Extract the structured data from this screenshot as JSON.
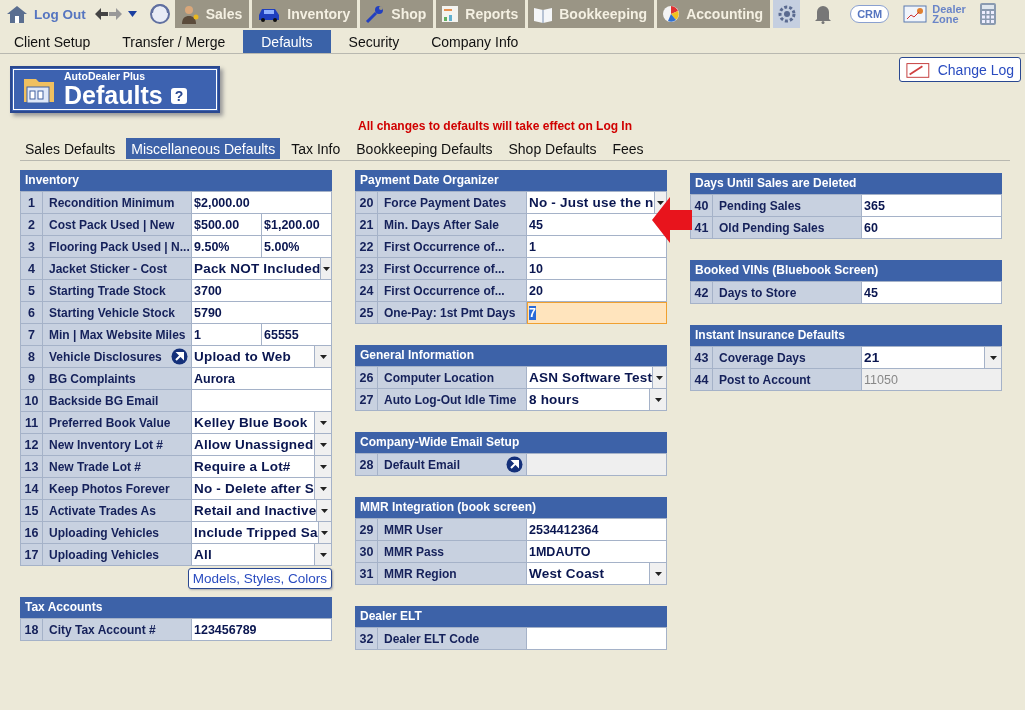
{
  "top_nav": {
    "logout": "Log Out",
    "tabs": [
      {
        "label": "Sales"
      },
      {
        "label": "Inventory"
      },
      {
        "label": "Shop"
      },
      {
        "label": "Reports"
      },
      {
        "label": "Bookkeeping"
      },
      {
        "label": "Accounting"
      }
    ],
    "crm": "CRM",
    "dealer_zone": "Dealer Zone"
  },
  "menu": [
    {
      "label": "Client Setup",
      "selected": false
    },
    {
      "label": "Transfer / Merge",
      "selected": false
    },
    {
      "label": "Defaults",
      "selected": true
    },
    {
      "label": "Security",
      "selected": false
    },
    {
      "label": "Company Info",
      "selected": false
    }
  ],
  "page_title": {
    "product": "AutoDealer Plus",
    "title": "Defaults",
    "help": "?"
  },
  "change_log": "Change Log",
  "notice": "All changes to defaults will take effect on Log In",
  "subtabs": [
    {
      "label": "Sales Defaults",
      "selected": false
    },
    {
      "label": "Miscellaneous Defaults",
      "selected": true
    },
    {
      "label": "Tax Info",
      "selected": false
    },
    {
      "label": "Bookkeeping Defaults",
      "selected": false
    },
    {
      "label": "Shop Defaults",
      "selected": false
    },
    {
      "label": "Fees",
      "selected": false
    }
  ],
  "columns": [
    [
      {
        "title": "Inventory",
        "button": "Models, Styles, Colors",
        "rows": [
          {
            "number": "1",
            "label": "Recondition Minimum",
            "kind": "text",
            "value": "$2,000.00",
            "linked": false,
            "focused": false
          },
          {
            "number": "2",
            "label": "Cost Pack Used | New",
            "kind": "pair",
            "values": [
              "$500.00",
              "$1,200.00"
            ],
            "linked": false,
            "focused": false
          },
          {
            "number": "3",
            "label": "Flooring Pack Used | N...",
            "kind": "pair",
            "values": [
              "9.50%",
              "5.00%"
            ],
            "linked": false,
            "focused": false
          },
          {
            "number": "4",
            "label": "Jacket Sticker - Cost",
            "kind": "select",
            "value": "Pack NOT Included",
            "linked": false,
            "focused": false
          },
          {
            "number": "5",
            "label": "Starting Trade Stock",
            "kind": "text",
            "value": "3700",
            "linked": false,
            "focused": false
          },
          {
            "number": "6",
            "label": "Starting Vehicle Stock",
            "kind": "text",
            "value": "5790",
            "linked": false,
            "focused": false
          },
          {
            "number": "7",
            "label": "Min | Max Website Miles",
            "kind": "pair",
            "values": [
              "1",
              "65555"
            ],
            "linked": false,
            "focused": false
          },
          {
            "number": "8",
            "label": "Vehicle Disclosures",
            "kind": "select",
            "value": "Upload to Web",
            "linked": true,
            "focused": false
          },
          {
            "number": "9",
            "label": "BG Complaints",
            "kind": "text",
            "value": "Aurora",
            "linked": false,
            "focused": false
          },
          {
            "number": "10",
            "label": "Backside BG Email",
            "kind": "text",
            "linked": false,
            "focused": false
          },
          {
            "number": "11",
            "label": "Preferred Book Value",
            "kind": "select",
            "value": "Kelley Blue Book",
            "linked": false,
            "focused": false
          },
          {
            "number": "12",
            "label": "New Inventory Lot #",
            "kind": "select",
            "value": "Allow Unassigned",
            "linked": false,
            "focused": false
          },
          {
            "number": "13",
            "label": "New Trade Lot #",
            "kind": "select",
            "value": "Require a Lot#",
            "linked": false,
            "focused": false
          },
          {
            "number": "14",
            "label": "Keep Photos Forever",
            "kind": "select",
            "value": "No - Delete after S",
            "linked": false,
            "focused": false
          },
          {
            "number": "15",
            "label": "Activate Trades As",
            "kind": "select",
            "value": "Retail and Inactive",
            "linked": false,
            "focused": false
          },
          {
            "number": "16",
            "label": "Uploading Vehicles",
            "kind": "select",
            "value": "Include Tripped Sa",
            "linked": false,
            "focused": false
          },
          {
            "number": "17",
            "label": "Uploading Vehicles",
            "kind": "select",
            "value": "All",
            "linked": false,
            "focused": false
          }
        ]
      },
      {
        "title": "Tax Accounts",
        "rows": [
          {
            "number": "18",
            "label": "City Tax Account #",
            "kind": "text",
            "value": "123456789",
            "linked": false,
            "focused": false
          }
        ]
      }
    ],
    [
      {
        "title": "Payment Date Organizer",
        "rows": [
          {
            "number": "20",
            "label": "Force Payment Dates",
            "kind": "select",
            "value": "No - Just use the n",
            "linked": false,
            "focused": false
          },
          {
            "number": "21",
            "label": "Min. Days After Sale",
            "kind": "text",
            "value": "45",
            "linked": false,
            "focused": false
          },
          {
            "number": "22",
            "label": "First Occurrence of...",
            "kind": "text",
            "value": "1",
            "linked": false,
            "focused": false
          },
          {
            "number": "23",
            "label": "First Occurrence of...",
            "kind": "text",
            "value": "10",
            "linked": false,
            "focused": false
          },
          {
            "number": "24",
            "label": "First Occurrence of...",
            "kind": "text",
            "value": "20",
            "linked": false,
            "focused": false
          },
          {
            "number": "25",
            "label": "One-Pay: 1st Pmt Days",
            "kind": "text",
            "value": "7",
            "linked": false,
            "focused": true
          }
        ]
      },
      {
        "title": "General Information",
        "rows": [
          {
            "number": "26",
            "label": "Computer Location",
            "kind": "select",
            "value": "ASN Software Test",
            "linked": false,
            "focused": false
          },
          {
            "number": "27",
            "label": "Auto Log-Out Idle Time",
            "kind": "select",
            "value": "8 hours",
            "linked": false,
            "focused": false
          }
        ]
      },
      {
        "title": "Company-Wide Email Setup",
        "rows": [
          {
            "number": "28",
            "label": "Default Email",
            "kind": "readonly",
            "linked": true,
            "focused": false
          }
        ]
      },
      {
        "title": "MMR Integration (book screen)",
        "rows": [
          {
            "number": "29",
            "label": "MMR User",
            "kind": "text",
            "value": "2534412364",
            "linked": false,
            "focused": false
          },
          {
            "number": "30",
            "label": "MMR Pass",
            "kind": "text",
            "value": "1MDAUTO",
            "linked": false,
            "focused": false
          },
          {
            "number": "31",
            "label": "MMR Region",
            "kind": "select",
            "value": "West Coast",
            "linked": false,
            "focused": false
          }
        ]
      },
      {
        "title": "Dealer ELT",
        "rows": [
          {
            "number": "32",
            "label": "Dealer ELT Code",
            "kind": "text",
            "linked": false,
            "focused": false
          }
        ]
      }
    ],
    [
      {
        "title": "Days Until Sales are Deleted",
        "rows": [
          {
            "number": "40",
            "label": "Pending Sales",
            "kind": "text",
            "value": "365",
            "linked": false,
            "focused": false
          },
          {
            "number": "41",
            "label": "Old Pending Sales",
            "kind": "text",
            "value": "60",
            "linked": false,
            "focused": false
          }
        ]
      },
      {
        "title": "Booked VINs (Bluebook Screen)",
        "rows": [
          {
            "number": "42",
            "label": "Days to Store",
            "kind": "text",
            "value": "45",
            "linked": false,
            "focused": false
          }
        ]
      },
      {
        "title": "Instant Insurance Defaults",
        "rows": [
          {
            "number": "43",
            "label": "Coverage Days",
            "kind": "select",
            "value": "21",
            "linked": false,
            "focused": false
          },
          {
            "number": "44",
            "label": "Post to Account",
            "kind": "readonly",
            "value": "11050",
            "linked": false,
            "focused": false
          }
        ]
      }
    ]
  ]
}
